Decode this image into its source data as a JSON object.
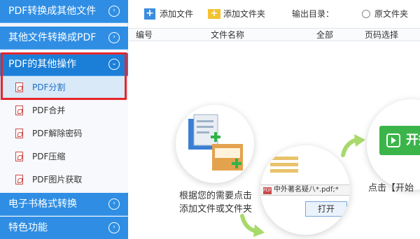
{
  "sidebar": {
    "categories": [
      {
        "label": "PDF转换成其他文件"
      },
      {
        "label": "其他文件转换成PDF"
      },
      {
        "label": "PDF的其他操作"
      },
      {
        "label": "电子书格式转换"
      },
      {
        "label": "特色功能"
      }
    ],
    "sub_items": [
      {
        "label": "PDF分割"
      },
      {
        "label": "PDF合并"
      },
      {
        "label": "PDF解除密码"
      },
      {
        "label": "PDF压缩"
      },
      {
        "label": "PDF图片获取"
      }
    ]
  },
  "toolbar": {
    "add_file_label": "添加文件",
    "add_folder_label": "添加文件夹",
    "output_label": "输出目录：",
    "output_option": "原文件夹"
  },
  "table": {
    "columns": [
      "编号",
      "文件名称",
      "全部",
      "页码选择"
    ]
  },
  "guide": {
    "step1_line1": "根据您的需要点击",
    "step1_line2": "添加文件或文件夹",
    "dialog_filename": "中外著名疑八*.pdf;*",
    "dialog_open_label": "打开",
    "start_button_label": "开始",
    "step3_caption": "点击【开始"
  },
  "colors": {
    "sidebar_blue": "#2f8ee4",
    "highlight_red": "#e6262b",
    "accent_green": "#3bb54a"
  }
}
